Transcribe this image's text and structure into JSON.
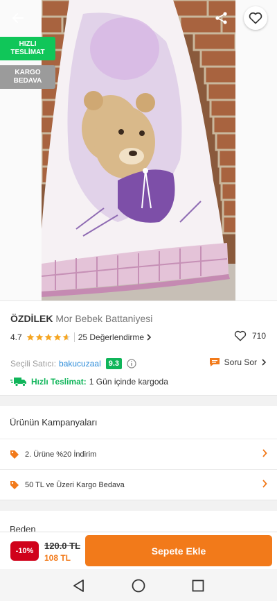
{
  "badges": {
    "fast_delivery": "HIZLI\nTESLİMAT",
    "free_cargo": "KARGO\nBEDAVA"
  },
  "product": {
    "brand": "ÖZDİLEK",
    "name": "Mor Bebek Battaniyesi",
    "rating": "4.7",
    "rating_stars_fraction": 0.94,
    "reviews": "25 Değerlendirme",
    "likes": "710"
  },
  "seller": {
    "label": "Seçili Satıcı:",
    "name": "bakucuzaal",
    "score": "9.3",
    "ask_label": "Soru Sor"
  },
  "delivery": {
    "label": "Hızlı Teslimat:",
    "text": "1 Gün içinde kargoda"
  },
  "campaigns": {
    "title": "Ürünün Kampanyaları",
    "items": [
      {
        "label": "2. Ürüne %20 İndirim"
      },
      {
        "label": "50 TL ve Üzeri Kargo Bedava"
      }
    ]
  },
  "size": {
    "title": "Beden"
  },
  "purchase": {
    "discount": "-10%",
    "old_price": "120.0 TL",
    "new_price": "108 TL",
    "cart_label": "Sepete Ekle"
  },
  "colors": {
    "accent": "#f27a1a",
    "green": "#10b55a",
    "discount_red": "#d0021b",
    "link_blue": "#2b8bd9"
  }
}
